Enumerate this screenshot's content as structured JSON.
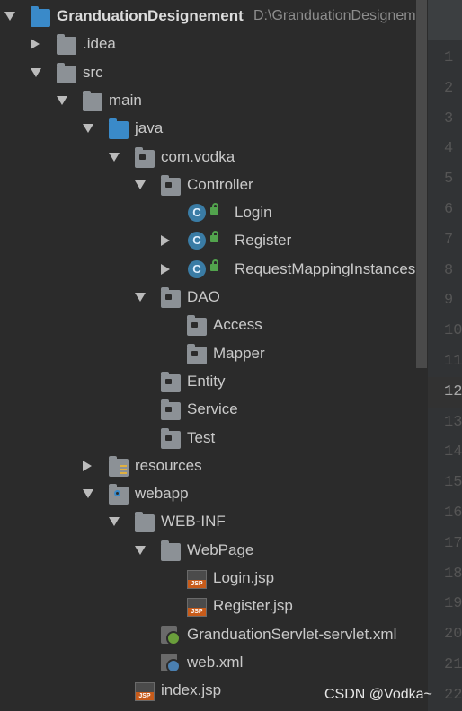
{
  "project": {
    "name": "GranduationDesignement",
    "path": "D:\\GranduationDesignement"
  },
  "tree": [
    {
      "label": "GranduationDesignement",
      "depth": 0,
      "arrow": "open",
      "icon": "project-folder-icon"
    },
    {
      "label": ".idea",
      "depth": 1,
      "arrow": "closed",
      "icon": "folder-icon"
    },
    {
      "label": "src",
      "depth": 1,
      "arrow": "open",
      "icon": "folder-icon"
    },
    {
      "label": "main",
      "depth": 2,
      "arrow": "open",
      "icon": "folder-icon"
    },
    {
      "label": "java",
      "depth": 3,
      "arrow": "open",
      "icon": "source-folder-icon"
    },
    {
      "label": "com.vodka",
      "depth": 4,
      "arrow": "open",
      "icon": "package-icon"
    },
    {
      "label": "Controller",
      "depth": 5,
      "arrow": "open",
      "icon": "package-icon"
    },
    {
      "label": "Login",
      "depth": 6,
      "arrow": "none",
      "icon": "class-icon"
    },
    {
      "label": "Register",
      "depth": 6,
      "arrow": "closed",
      "icon": "class-icon"
    },
    {
      "label": "RequestMappingInstances",
      "depth": 6,
      "arrow": "closed",
      "icon": "class-icon"
    },
    {
      "label": "DAO",
      "depth": 5,
      "arrow": "open",
      "icon": "package-icon"
    },
    {
      "label": "Access",
      "depth": 6,
      "arrow": "none",
      "icon": "package-icon"
    },
    {
      "label": "Mapper",
      "depth": 6,
      "arrow": "none",
      "icon": "package-icon"
    },
    {
      "label": "Entity",
      "depth": 5,
      "arrow": "none",
      "icon": "package-icon"
    },
    {
      "label": "Service",
      "depth": 5,
      "arrow": "none",
      "icon": "package-icon"
    },
    {
      "label": "Test",
      "depth": 5,
      "arrow": "none",
      "icon": "package-icon"
    },
    {
      "label": "resources",
      "depth": 3,
      "arrow": "closed",
      "icon": "resources-folder-icon"
    },
    {
      "label": "webapp",
      "depth": 3,
      "arrow": "open",
      "icon": "web-folder-icon"
    },
    {
      "label": "WEB-INF",
      "depth": 4,
      "arrow": "open",
      "icon": "folder-icon"
    },
    {
      "label": "WebPage",
      "depth": 5,
      "arrow": "open",
      "icon": "folder-icon"
    },
    {
      "label": "Login.jsp",
      "depth": 6,
      "arrow": "none",
      "icon": "jsp-file-icon"
    },
    {
      "label": "Register.jsp",
      "depth": 6,
      "arrow": "none",
      "icon": "jsp-file-icon"
    },
    {
      "label": "GranduationServlet-servlet.xml",
      "depth": 5,
      "arrow": "none",
      "icon": "spring-xml-file-icon"
    },
    {
      "label": "web.xml",
      "depth": 5,
      "arrow": "none",
      "icon": "web-xml-file-icon"
    },
    {
      "label": "index.jsp",
      "depth": 4,
      "arrow": "none",
      "icon": "jsp-file-icon"
    }
  ],
  "gutter": {
    "lines": [
      "1",
      "2",
      "3",
      "4",
      "5",
      "6",
      "7",
      "8",
      "9",
      "10",
      "11",
      "12",
      "13",
      "14",
      "15",
      "16",
      "17",
      "18",
      "19",
      "20",
      "21",
      "22"
    ],
    "current": "12"
  },
  "watermark": "CSDN @Vodka~"
}
